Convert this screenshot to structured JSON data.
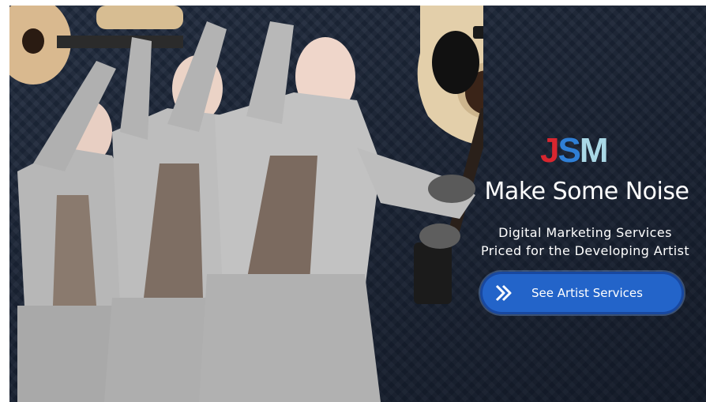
{
  "brand": {
    "logo_part1": "J",
    "logo_part2": "S",
    "logo_part3": "M",
    "colors": {
      "red": "#d8262f",
      "blue": "#2f7fd6",
      "light": "#a9d8e6"
    }
  },
  "hero": {
    "headline": "Make Some Noise",
    "subline1": "Digital Marketing Services",
    "subline2": "Priced for the Developing Artist",
    "cta_label": "See Artist Services",
    "cta_icon": "double-chevron-right-icon",
    "cta_color": "#2364c9",
    "background_color": "#1f2a3d"
  }
}
